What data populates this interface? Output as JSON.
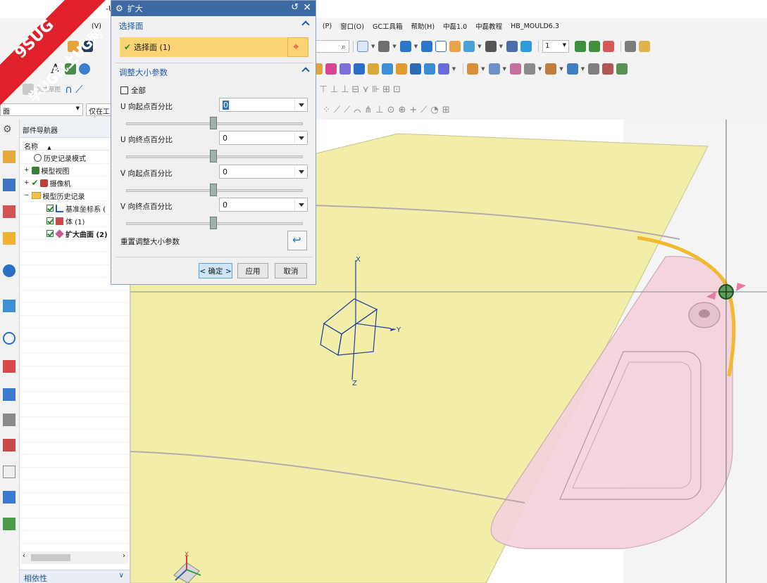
{
  "app": {
    "title_fragment": "-U"
  },
  "watermark": {
    "line1": "9SUG",
    "line2": "学UG就上UG网"
  },
  "menubar": {
    "items": [
      "(V)",
      "(P)",
      "窗口(O)",
      "GC工具箱",
      "帮助(H)",
      "中磊1.0",
      "中磊教程",
      "HB_MOULD6.3"
    ]
  },
  "toolbar": {
    "finish_sketch_label": "完成草图",
    "filter_label": "面",
    "filter_scope_label": "仅在工",
    "layer_value": "1"
  },
  "navigator": {
    "title": "部件导航器",
    "column_name": "名称",
    "items": [
      {
        "label": "历史记录模式",
        "icon": "clock-icon",
        "level": 0
      },
      {
        "label": "模型视图",
        "icon": "model-view-icon",
        "level": 0
      },
      {
        "label": "摄像机",
        "icon": "camera-icon",
        "level": 0
      },
      {
        "label": "模型历史记录",
        "icon": "folder-icon",
        "level": 0
      },
      {
        "label": "基准坐标系 (",
        "icon": "datum-csys-icon",
        "level": 1
      },
      {
        "label": "体 (1)",
        "icon": "body-icon",
        "level": 1
      },
      {
        "label": "扩大曲面 (2)",
        "icon": "enlarge-surface-icon",
        "level": 1
      }
    ],
    "footer_label": "相依性"
  },
  "dialog": {
    "title": "扩大",
    "select_face_section": "选择面",
    "selection_label": "选择面 (1)",
    "resize_section": "调整大小参数",
    "all_checkbox_label": "全部",
    "all_checked": false,
    "params": [
      {
        "label": "U 向起点百分比",
        "value": "0",
        "slider_fraction": 0.5
      },
      {
        "label": "U 向终点百分比",
        "value": "0",
        "slider_fraction": 0.5
      },
      {
        "label": "V 向起点百分比",
        "value": "0",
        "slider_fraction": 0.5
      },
      {
        "label": "V 向终点百分比",
        "value": "0",
        "slider_fraction": 0.5
      }
    ],
    "reset_label": "重置调整大小参数",
    "ok_label": "< 确定 >",
    "apply_label": "应用",
    "cancel_label": "取消"
  },
  "viewport": {
    "axis_x": "X",
    "axis_y": "Y",
    "axis_z": "Z",
    "corner_axis_x": "X"
  },
  "colors": {
    "surface": "#f2eeaa",
    "part": "#f4d2dc",
    "edge_highlight": "#f2b830",
    "axis_triad": "#1f3d9a",
    "dialog_title": "#3e6aa3",
    "selection": "#fbd374"
  }
}
